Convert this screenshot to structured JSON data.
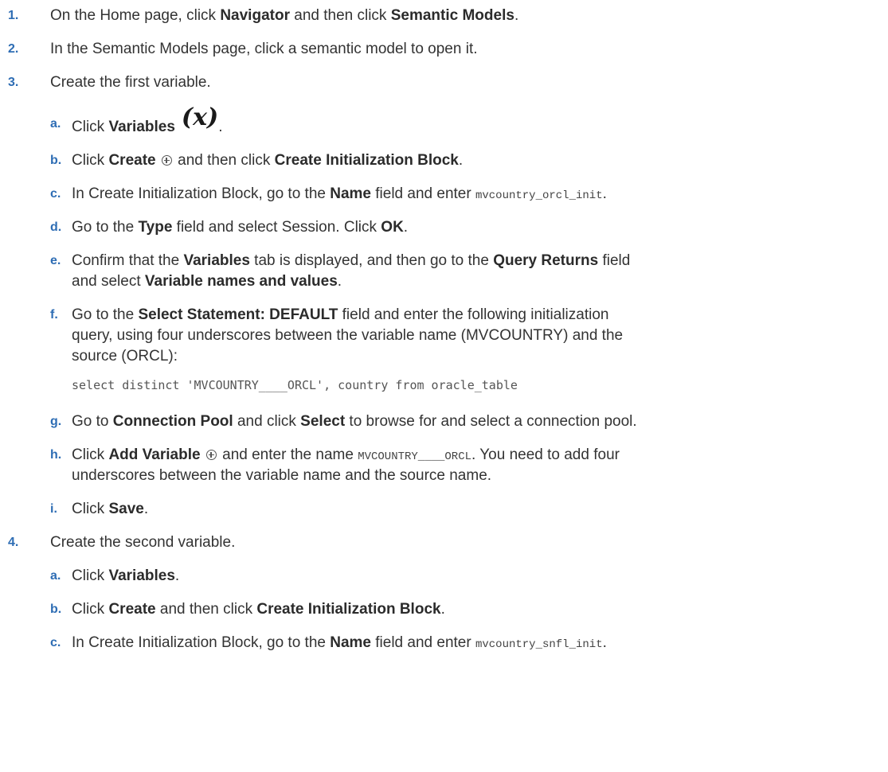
{
  "steps": [
    {
      "num": "1.",
      "pre": "On the Home page, click ",
      "b1": "Navigator",
      "mid": " and then click ",
      "b2": "Semantic Models",
      "post": "."
    },
    {
      "num": "2.",
      "text": "In the Semantic Models page, click a semantic model to open it."
    },
    {
      "num": "3.",
      "text": "Create the first variable."
    },
    {
      "num": "4.",
      "text": "Create the second variable."
    }
  ],
  "sub3": {
    "a": {
      "num": "a.",
      "pre": "Click ",
      "b": "Variables",
      "icon": "(x)",
      "post": "."
    },
    "b": {
      "num": "b.",
      "pre": "Click ",
      "b1": "Create",
      "mid": " and then click ",
      "b2": "Create Initialization Block",
      "post": "."
    },
    "c": {
      "num": "c.",
      "pre": "In Create Initialization Block, go to the ",
      "b": "Name",
      "mid": " field and enter ",
      "code": "mvcountry_orcl_init",
      "post": "."
    },
    "d": {
      "num": "d.",
      "pre": "Go to the ",
      "b1": "Type",
      "mid": " field and select Session. Click ",
      "b2": "OK",
      "post": "."
    },
    "e": {
      "num": "e.",
      "pre": "Confirm that the ",
      "b1": "Variables",
      "mid": " tab is displayed, and then go to the ",
      "b2": "Query Returns",
      "post": " field",
      "line2pre": "and select ",
      "line2b": "Variable names and values",
      "line2post": "."
    },
    "f": {
      "num": "f.",
      "pre": "Go to the ",
      "b": "Select Statement: DEFAULT",
      "post": " field and enter the following initialization",
      "line2": "query, using four underscores between the variable name (MVCOUNTRY) and the",
      "line3": "source (ORCL):",
      "code": "select distinct 'MVCOUNTRY____ORCL', country from oracle_table"
    },
    "g": {
      "num": "g.",
      "pre": "Go to ",
      "b1": "Connection Pool",
      "mid": " and click ",
      "b2": "Select",
      "post": " to browse for and select a connection pool."
    },
    "h": {
      "num": "h.",
      "pre": "Click ",
      "b": "Add Variable",
      "mid": " and enter the name ",
      "code": "MVCOUNTRY____ORCL",
      "post": ". You need to add four",
      "line2": "underscores between the variable name and the source name."
    },
    "i": {
      "num": "i.",
      "pre": "Click ",
      "b": "Save",
      "post": "."
    }
  },
  "sub4": {
    "a": {
      "num": "a.",
      "pre": "Click ",
      "b": "Variables",
      "post": "."
    },
    "b": {
      "num": "b.",
      "pre": "Click ",
      "b1": "Create",
      "mid": " and then click ",
      "b2": "Create Initialization Block",
      "post": "."
    },
    "c": {
      "num": "c.",
      "pre": "In Create Initialization Block, go to the ",
      "b": "Name",
      "mid": " field and enter ",
      "code": "mvcountry_snfl_init",
      "post": "."
    }
  }
}
